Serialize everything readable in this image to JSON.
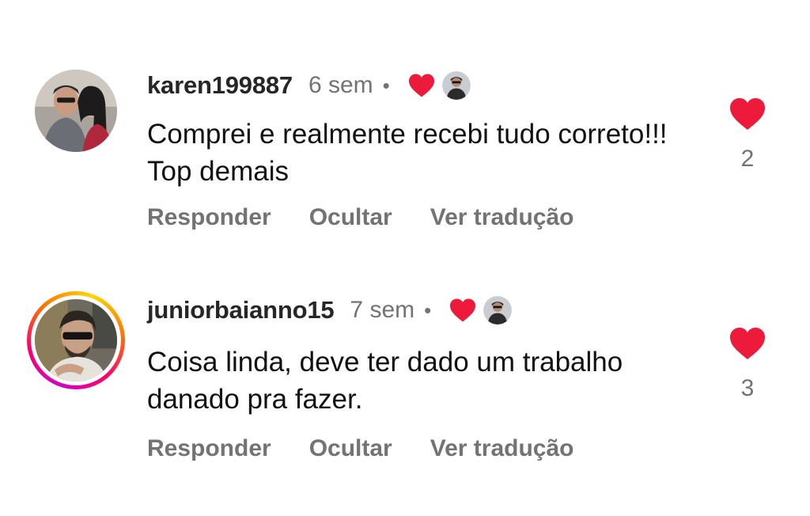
{
  "colors": {
    "heart": "#ed1a3b",
    "username": "#262626",
    "secondary_text": "#737373",
    "body_text": "#111111"
  },
  "comments": [
    {
      "username": "karen199887",
      "time": "6 sem",
      "separator": "•",
      "text": "Comprei e realmente recebi tudo correto!!! Top demais",
      "actions": [
        "Responder",
        "Ocultar",
        "Ver tradução"
      ],
      "likes": "2",
      "creator_liked": true,
      "has_story_ring": false
    },
    {
      "username": "juniorbaianno15",
      "time": "7 sem",
      "separator": "•",
      "text": "Coisa linda, deve ter dado um trabalho danado pra fazer.",
      "actions": [
        "Responder",
        "Ocultar",
        "Ver tradução"
      ],
      "likes": "3",
      "creator_liked": true,
      "has_story_ring": true
    }
  ],
  "icons": {
    "like": "heart-filled-icon",
    "creator_like": "heart-filled-icon",
    "creator_avatar": "creator-avatar-icon"
  }
}
